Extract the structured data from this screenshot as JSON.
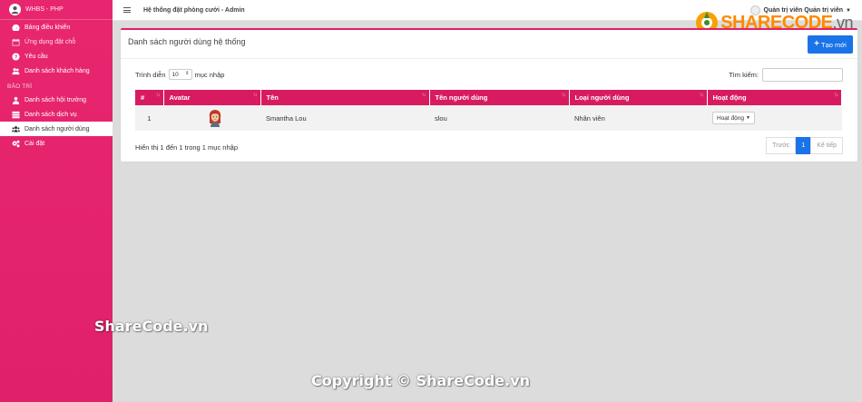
{
  "sidebar": {
    "brand": "WHBS - PHP",
    "items": [
      {
        "label": "Bảng điều khiển",
        "icon": "dashboard-icon"
      },
      {
        "label": "Ứng dụng đặt chỗ",
        "icon": "calendar-icon"
      },
      {
        "label": "Yêu cầu",
        "icon": "question-icon"
      }
    ],
    "customers_label": "Danh sách khách hàng",
    "section_label": "BẢO TRÌ",
    "maint_items": [
      {
        "label": "Danh sách hội trường",
        "icon": "building-icon"
      },
      {
        "label": "Danh sách dịch vụ",
        "icon": "table-icon"
      },
      {
        "label": "Danh sách người dùng",
        "icon": "users-icon"
      },
      {
        "label": "Cài đặt",
        "icon": "gears-icon"
      }
    ]
  },
  "topbar": {
    "title": "Hệ thống đặt phòng cưới - Admin",
    "user_name": "Quản trị viên Quản trị viên"
  },
  "logo": {
    "name": "SHARECODE",
    "domain": ".vn"
  },
  "card": {
    "title": "Danh sách người dùng hệ thống",
    "new_button": "Tạo mới"
  },
  "table_controls": {
    "show_label": "Trình diễn",
    "length_value": "10",
    "entries_label": "mục nhập",
    "search_label": "Tìm kiếm:"
  },
  "table": {
    "columns": [
      "#",
      "Avatar",
      "Tên",
      "Tên người dùng",
      "Loại người dùng",
      "Hoạt động"
    ],
    "rows": [
      {
        "index": "1",
        "name": "Smantha Lou",
        "username": "slou",
        "type": "Nhân viên",
        "action": "Hoạt động"
      }
    ]
  },
  "footer": {
    "info": "Hiển thị 1 đến 1 trong 1 mục nhập",
    "prev": "Trước",
    "page": "1",
    "next": "Kế tiếp"
  },
  "watermarks": {
    "side": "ShareCode.vn",
    "bottom": "Copyright © ShareCode.vn"
  },
  "colors": {
    "accent": "#e0216a",
    "primary": "#1a73e8"
  }
}
